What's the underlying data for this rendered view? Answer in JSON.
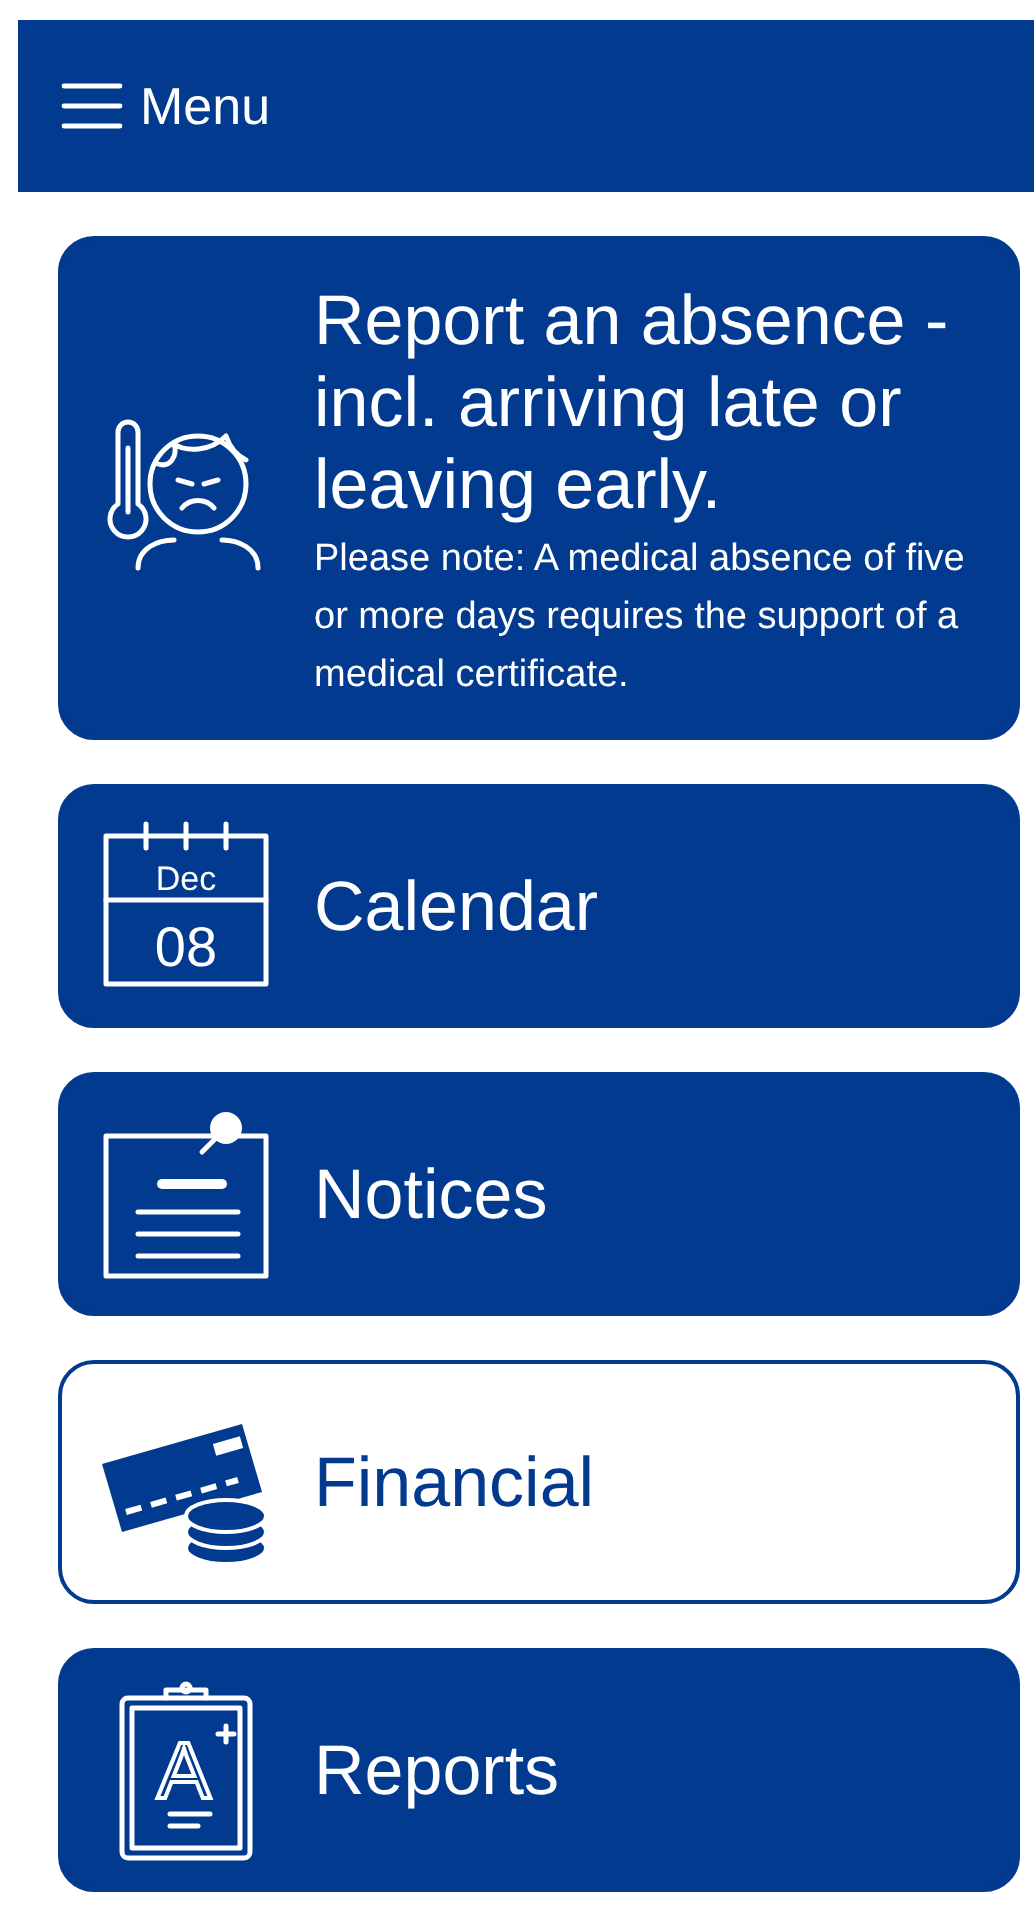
{
  "header": {
    "menu_label": "Menu"
  },
  "tiles": [
    {
      "kind": "sick",
      "title": "Report an absence - incl. arriving late or leaving early.",
      "note": "Please note: A medical absence of five or more days requires the support of a medical certificate.",
      "selected": false
    },
    {
      "kind": "calendar",
      "title": "Calendar",
      "icon_month": "Dec",
      "icon_day": "08",
      "selected": false
    },
    {
      "kind": "notice",
      "title": "Notices",
      "selected": false
    },
    {
      "kind": "money",
      "title": "Financial",
      "selected": true
    },
    {
      "kind": "report",
      "title": "Reports",
      "icon_letter": "A",
      "selected": false
    }
  ]
}
